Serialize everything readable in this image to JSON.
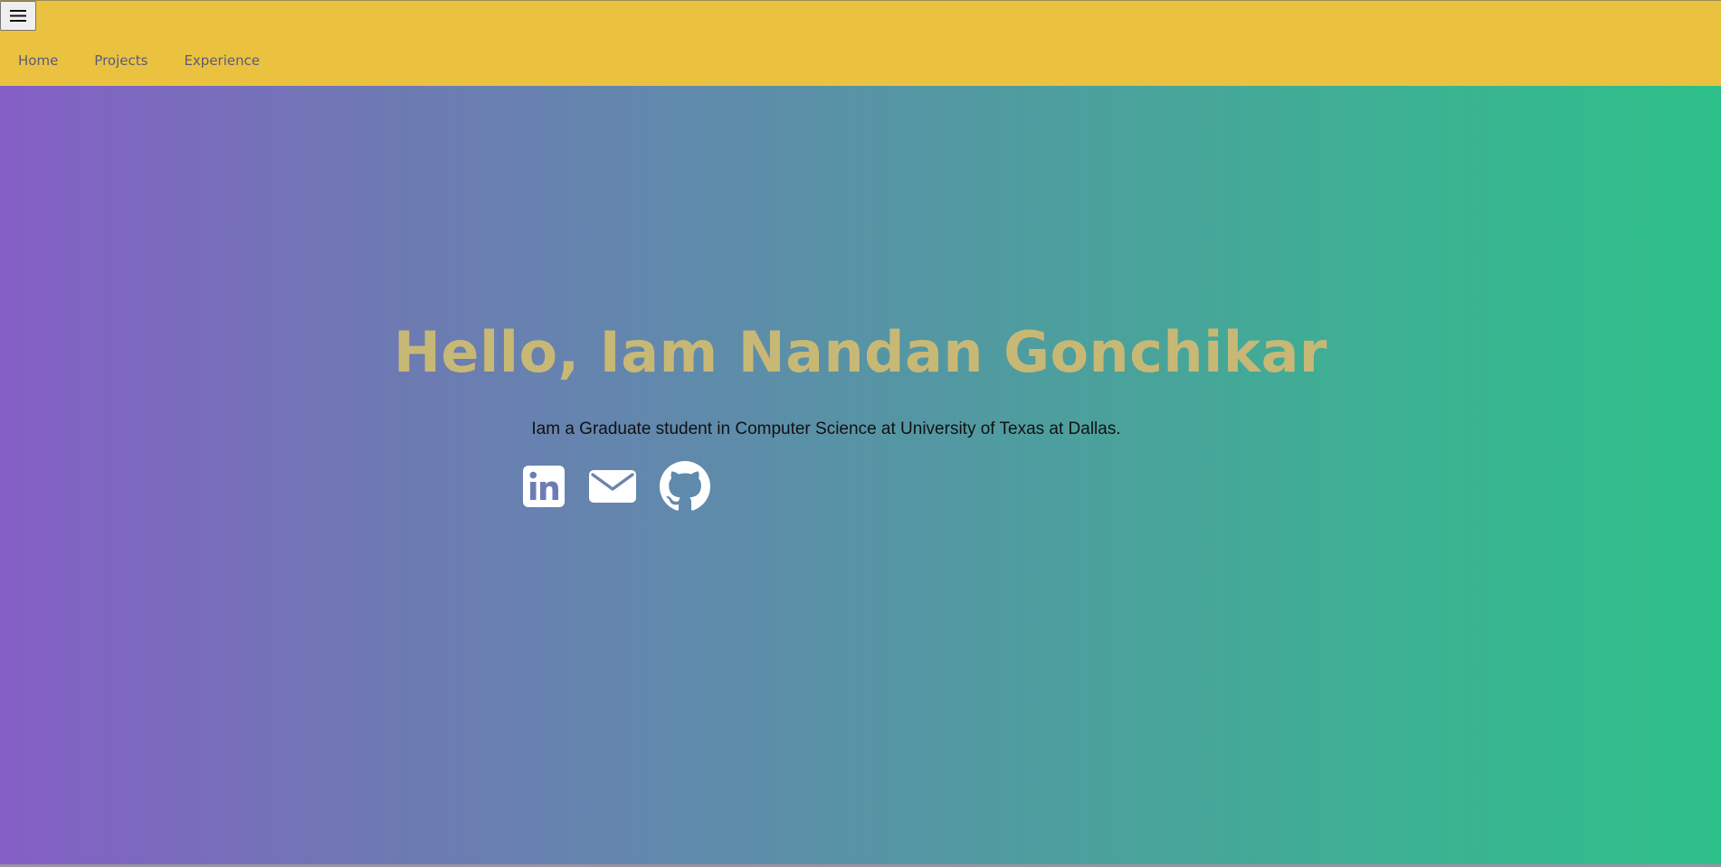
{
  "nav": {
    "menu_icon": "hamburger-menu-icon",
    "links": [
      "Home",
      "Projects",
      "Experience"
    ]
  },
  "hero": {
    "title": "Hello, Iam Nandan Gonchikar",
    "subtitle": "Iam a Graduate student in Computer Science at University of Texas at Dallas.",
    "socials": [
      {
        "icon": "linkedin-icon"
      },
      {
        "icon": "mail-icon"
      },
      {
        "icon": "github-icon"
      }
    ]
  },
  "colors": {
    "navbar": "#ebc240",
    "nav_link": "#5b5a78",
    "title": "#c8b876",
    "gradient_start": "#855fc6",
    "gradient_end": "#2ec08a",
    "icons": "#ffffff"
  }
}
